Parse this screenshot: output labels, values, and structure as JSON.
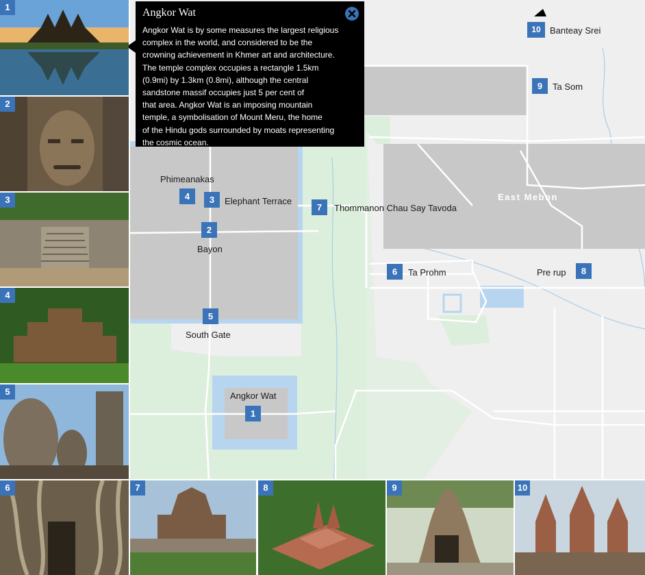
{
  "popup": {
    "title": "Angkor Wat",
    "lines": [
      "Angkor Wat is by some measures the largest religious",
      "complex in the world, and considered to be the",
      "crowning achievement in Khmer art and architecture.",
      "The temple complex occupies a rectangle 1.5km",
      "(0.9mi) by 1.3km (0.8mi), although the central",
      "sandstone massif occupies just 5 per cent of",
      "that area. Angkor Wat is an imposing mountain",
      "temple, a symbolisation of Mount Meru, the home",
      "of the Hindu gods surrounded by moats representing",
      "the cosmic ocean."
    ],
    "close_icon": "close-icon"
  },
  "markers": [
    {
      "num": "1",
      "label": "Angkor Wat"
    },
    {
      "num": "2",
      "label": "Bayon"
    },
    {
      "num": "3",
      "label": "Elephant Terrace"
    },
    {
      "num": "4",
      "label": "Phimeanakas"
    },
    {
      "num": "5",
      "label": "South Gate"
    },
    {
      "num": "6",
      "label": "Ta Prohm"
    },
    {
      "num": "7",
      "label": "Thommanon Chau Say Tavoda"
    },
    {
      "num": "8",
      "label": "Pre rup"
    },
    {
      "num": "9",
      "label": "Ta Som"
    },
    {
      "num": "10",
      "label": "Banteay Srei"
    }
  ],
  "region_label": "East Mebon",
  "thumbnails": [
    {
      "num": "1"
    },
    {
      "num": "2"
    },
    {
      "num": "3"
    },
    {
      "num": "4"
    },
    {
      "num": "5"
    },
    {
      "num": "6"
    },
    {
      "num": "7"
    },
    {
      "num": "8"
    },
    {
      "num": "9"
    },
    {
      "num": "10"
    }
  ],
  "colors": {
    "marker": "#3b73b9",
    "popup_bg": "#000000",
    "map_bg": "#efefef",
    "block": "#c8c8c8",
    "park": "#dcefdc",
    "water": "#b7d5ef",
    "road": "#ffffff"
  },
  "icons": {
    "north_arrow": "north-arrow-icon"
  }
}
